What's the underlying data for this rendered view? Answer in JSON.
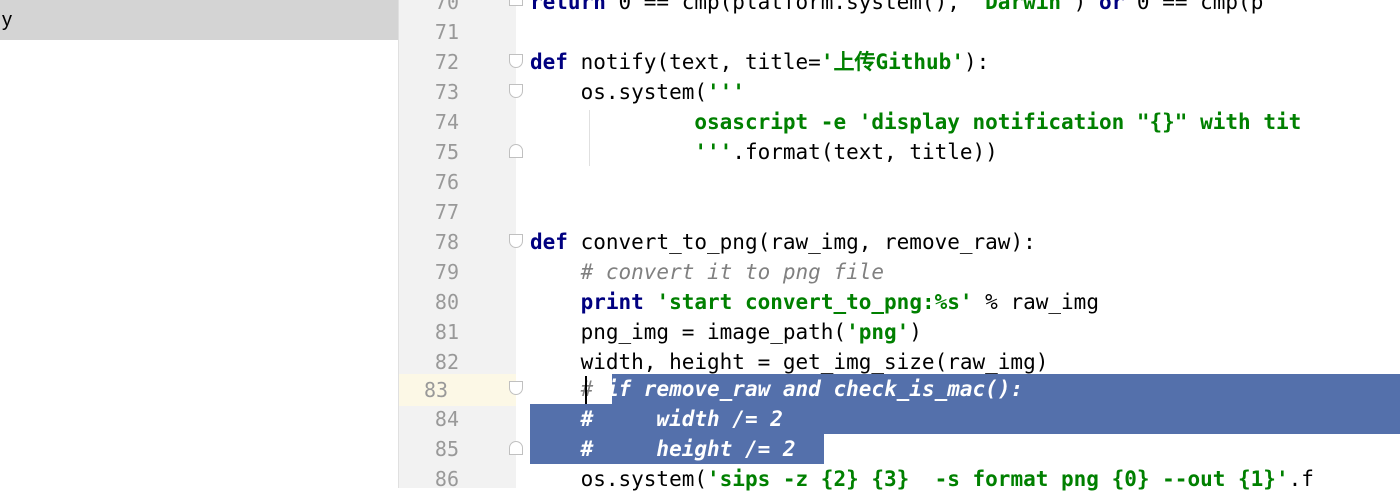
{
  "left_panel": {
    "item_label": "y"
  },
  "lines": [
    {
      "num": "70",
      "code": "return 0 == cmp(platform.system(), 'Darwin') or 0 == cmp(p"
    },
    {
      "num": "71",
      "code": ""
    },
    {
      "num": "72",
      "code": "def notify(text, title='上传Github'):"
    },
    {
      "num": "73",
      "code": "    os.system('''"
    },
    {
      "num": "74",
      "code": "             osascript -e 'display notification \"{}\" with tit"
    },
    {
      "num": "75",
      "code": "             '''.format(text, title))"
    },
    {
      "num": "76",
      "code": ""
    },
    {
      "num": "77",
      "code": ""
    },
    {
      "num": "78",
      "code": "def convert_to_png(raw_img, remove_raw):"
    },
    {
      "num": "79",
      "code": "    # convert it to png file"
    },
    {
      "num": "80",
      "code": "    print 'start convert_to_png:%s' % raw_img"
    },
    {
      "num": "81",
      "code": "    png_img = image_path('png')"
    },
    {
      "num": "82",
      "code": "    width, height = get_img_size(raw_img)"
    },
    {
      "num": "83",
      "code": "    # if remove_raw and check_is_mac():"
    },
    {
      "num": "84",
      "code": "    #     width /= 2"
    },
    {
      "num": "85",
      "code": "    #     height /= 2"
    },
    {
      "num": "86",
      "code": "    os.system('sips -z {2} {3}  -s format png {0} --out {1}'.f"
    }
  ],
  "current_line": "83",
  "colors": {
    "keyword": "#000080",
    "string": "#008000",
    "comment": "#808080",
    "selection": "#5470ab",
    "current_line_bg": "#fcf8e6"
  }
}
